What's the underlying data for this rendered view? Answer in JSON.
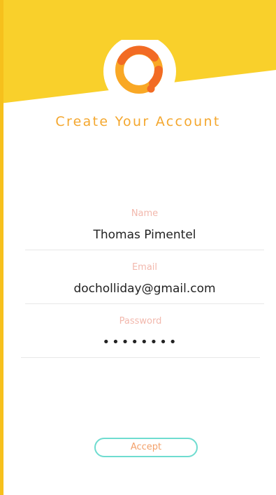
{
  "header": {
    "title": "Create Your Account",
    "logo_icon": "q-logo-icon"
  },
  "form": {
    "name": {
      "label": "Name",
      "value": "Thomas Pimentel"
    },
    "email": {
      "label": "Email",
      "value": "docholliday@gmail.com"
    },
    "password": {
      "label": "Password",
      "value": "••••••••"
    }
  },
  "actions": {
    "accept_label": "Accept"
  },
  "colors": {
    "header_yellow": "#f9d02b",
    "title_orange": "#f4a72e",
    "label_pink": "#f2b8ad",
    "button_teal": "#6fdcd0"
  }
}
